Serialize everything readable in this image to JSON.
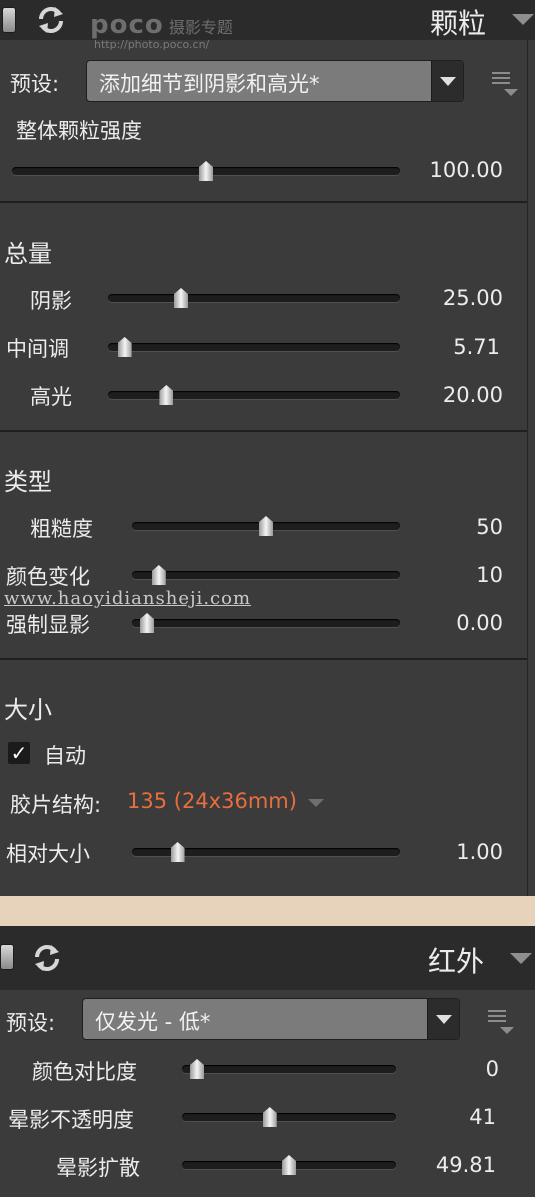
{
  "grain_panel": {
    "title": "颗粒",
    "watermark": {
      "brand": "poco",
      "brand_cn": "摄影专题",
      "url": "http://photo.poco.cn/"
    },
    "preset_label": "预设:",
    "preset_value": "添加细节到阴影和高光*",
    "overall_strength": {
      "label": "整体颗粒强度",
      "value": "100.00",
      "level": 0.5
    },
    "amount": {
      "title": "总量",
      "sliders": [
        {
          "label": "阴影",
          "value": "25.00",
          "level": 0.25
        },
        {
          "label": "中间调",
          "value": "5.71",
          "level": 0.057
        },
        {
          "label": "高光",
          "value": "20.00",
          "level": 0.2
        }
      ]
    },
    "type": {
      "title": "类型",
      "sliders": [
        {
          "label": "粗糙度",
          "value": "50",
          "level": 0.5
        },
        {
          "label": "颜色变化",
          "value": "10",
          "level": 0.1
        },
        {
          "label": "强制显影",
          "value": "0.00",
          "level": 0.0
        }
      ]
    },
    "size": {
      "title": "大小",
      "auto_label": "自动",
      "auto_checked": true,
      "film_label": "胶片结构:",
      "film_value": "135 (24x36mm)",
      "relative_size": {
        "label": "相对大小",
        "value": "1.00",
        "level": 0.17
      }
    },
    "site_watermark": "www.haoyidiansheji.com"
  },
  "infrared_panel": {
    "title": "红外",
    "preset_label": "预设:",
    "preset_value": "仅发光 - 低*",
    "sliders": [
      {
        "label": "颜色对比度",
        "value": "0",
        "level": 0.0
      },
      {
        "label": "晕影不透明度",
        "value": "41",
        "level": 0.41
      },
      {
        "label": "晕影扩散",
        "value": "49.81",
        "level": 0.5
      }
    ]
  },
  "colors": {
    "background": "#3b3b3b",
    "header": "#2b2b2b",
    "accent_orange": "#e86e3d",
    "separator_band": "#e7d3bc"
  }
}
